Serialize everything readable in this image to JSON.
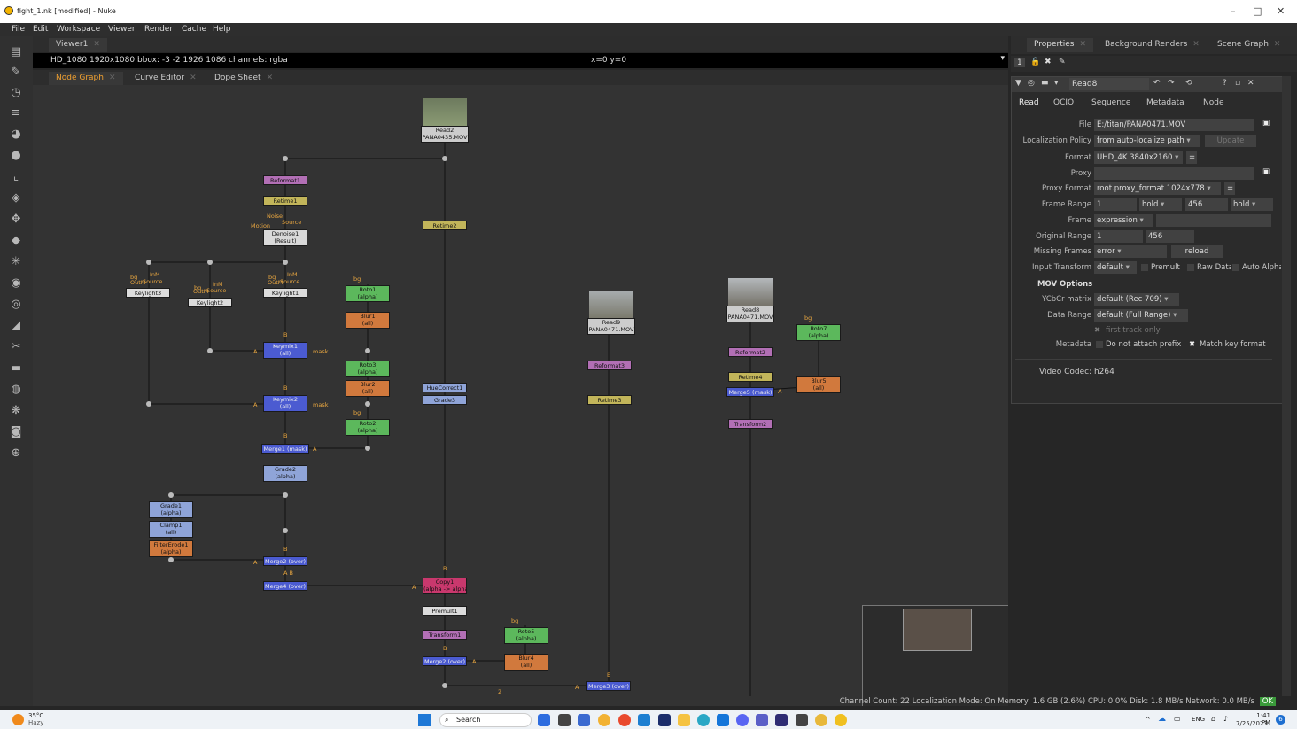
{
  "window": {
    "title": "fight_1.nk [modified] - Nuke",
    "minimize": "–",
    "maximize": "□",
    "close": "✕"
  },
  "menu": [
    "File",
    "Edit",
    "Workspace",
    "Viewer",
    "Render",
    "Cache",
    "Help"
  ],
  "viewer": {
    "tab": "Viewer1",
    "info": "HD_1080 1920x1080  bbox: -3 -2 1926 1086 channels: rgba",
    "coords": "x=0 y=0"
  },
  "graph_tabs": [
    "Node Graph",
    "Curve Editor",
    "Dope Sheet"
  ],
  "nodes": {
    "read2": [
      "Read2",
      "PANA0435.MOV"
    ],
    "read9": [
      "Read9",
      "PANA0471.MOV"
    ],
    "read8": [
      "Read8",
      "PANA0471.MOV"
    ],
    "reformat1": "Reformat1",
    "retime1": "Retime1",
    "denoise1": [
      "Denoise1",
      "(Result)"
    ],
    "retime2": "Retime2",
    "keylight3": "Keylight3",
    "keylight2": "Keylight2",
    "keylight1": "Keylight1",
    "roto1": [
      "Roto1",
      "(alpha)"
    ],
    "blur1": [
      "Blur1",
      "(all)"
    ],
    "keymix1": [
      "Keymix1",
      "(all)"
    ],
    "roto3": [
      "Roto3",
      "(alpha)"
    ],
    "blur2": [
      "Blur2",
      "(all)"
    ],
    "huecorrect1": "HueCorrect1",
    "grade3": "Grade3",
    "keymix2": [
      "Keymix2",
      "(all)"
    ],
    "roto2": [
      "Roto2",
      "(alpha)"
    ],
    "merge1": "Merge1 (mask)",
    "grade2": [
      "Grade2",
      "(alpha)"
    ],
    "grade1": [
      "Grade1",
      "(alpha)"
    ],
    "clamp1": [
      "Clamp1",
      "(all)"
    ],
    "filtererode1": [
      "FilterErode1",
      "(alpha)"
    ],
    "merge2": "Merge2 (over)",
    "merge4": "Merge4 (over)",
    "copy1": [
      "Copy1",
      "(alpha -> alpha)"
    ],
    "premult1": "Premult1",
    "transform1": "Transform1",
    "roto5": [
      "Roto5",
      "(alpha)"
    ],
    "blur4": [
      "Blur4",
      "(all)"
    ],
    "mergeb": "Merge2 (over)",
    "merge3": "Merge3 (over)",
    "reformat3": "Reformat3",
    "retime3": "Retime3",
    "reformat2": "Reformat2",
    "retime4": "Retime4",
    "merge5": "Merge5 (mask)",
    "transform2": "Transform2",
    "roto7": [
      "Roto7",
      "(alpha)"
    ],
    "blur5": [
      "Blur5",
      "(all)"
    ]
  },
  "pin_labels": {
    "bg": "bg",
    "a": "A",
    "b": "B",
    "mask": "mask",
    "inm": "InM",
    "outm": "OutM",
    "source": "Source",
    "noise": "Noise",
    "motion": "Motion",
    "two": "2"
  },
  "properties": {
    "tabs": [
      "Properties",
      "Background Renders",
      "Scene Graph"
    ],
    "count": "1",
    "node_name": "Read8",
    "subtabs": [
      "Read",
      "OCIO",
      "Sequence",
      "Metadata",
      "Node"
    ],
    "file_label": "File",
    "file": "E:/titan/PANA0471.MOV",
    "loc_label": "Localization Policy",
    "loc": "from auto-localize path",
    "update": "Update",
    "format_label": "Format",
    "format": "UHD_4K 3840x2160",
    "proxy_label": "Proxy",
    "proxy": "",
    "proxyfmt_label": "Proxy Format",
    "proxyfmt": "root.proxy_format 1024x778",
    "range_label": "Frame Range",
    "range_start": "1",
    "range_before": "hold",
    "range_end": "456",
    "range_after": "hold",
    "frame_label": "Frame",
    "frame": "expression",
    "orig_label": "Original Range",
    "orig_start": "1",
    "orig_end": "456",
    "missing_label": "Missing Frames",
    "missing": "error",
    "reload": "reload",
    "input_label": "Input Transform",
    "input": "default",
    "premult": "Premult",
    "rawdata": "Raw Data",
    "autoalpha": "Auto Alpha",
    "mov_header": "MOV Options",
    "ycbcr_label": "YCbCr matrix",
    "ycbcr": "default (Rec 709)",
    "drange_label": "Data Range",
    "drange": "default (Full Range)",
    "first_track": "first track only",
    "meta_label": "Metadata",
    "noprefix": "Do not attach prefix",
    "matchkey": "Match key format",
    "codec": "Video Codec: h264"
  },
  "status": "Channel Count: 22  Localization Mode: On  Memory: 1.6 GB (2.6%)  CPU: 0.0%  Disk: 1.8 MB/s  Network: 0.0 MB/s",
  "status_badge": "OK",
  "taskbar": {
    "temp": "35°C",
    "weather": "Hazy",
    "search": "Search",
    "lang": "ENG",
    "time": "1:41 PM",
    "date": "7/25/2023",
    "notif": "6"
  }
}
